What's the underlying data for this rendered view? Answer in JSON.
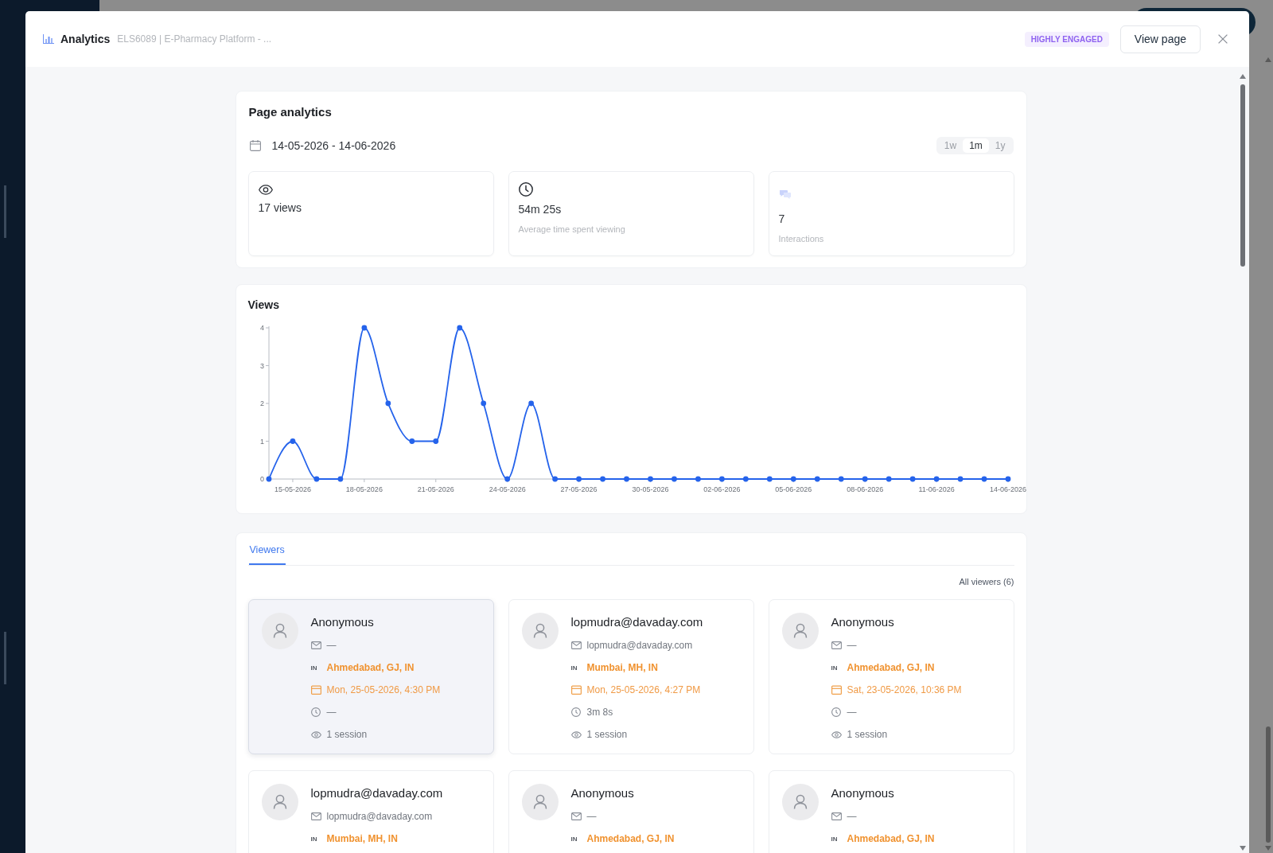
{
  "modal": {
    "title": "Analytics",
    "subtitle": "ELS6089 | E-Pharmacy Platform - ...",
    "badge": "HIGHLY ENGAGED",
    "view_button": "View page"
  },
  "page_analytics": {
    "title": "Page analytics",
    "date_range": "14-05-2026 - 14-06-2026",
    "ranges": [
      {
        "label": "1w",
        "selected": false
      },
      {
        "label": "1m",
        "selected": true
      },
      {
        "label": "1y",
        "selected": false
      }
    ],
    "stats": [
      {
        "kind": "views",
        "value": "17 views"
      },
      {
        "kind": "time",
        "value": "54m 25s",
        "caption": "Average time spent viewing"
      },
      {
        "kind": "interactions",
        "value": "7",
        "caption": "Interactions"
      }
    ]
  },
  "views_chart": {
    "chart_data": {
      "type": "line",
      "title": "Views",
      "categories": [
        null,
        "15-05-2026",
        null,
        null,
        "18-05-2026",
        null,
        null,
        "21-05-2026",
        null,
        null,
        "24-05-2026",
        null,
        null,
        "27-05-2026",
        null,
        null,
        "30-05-2026",
        null,
        null,
        "02-06-2026",
        null,
        null,
        "05-06-2026",
        null,
        null,
        "08-06-2026",
        null,
        null,
        "11-06-2026",
        null,
        null,
        "14-06-2026"
      ],
      "ylim": [
        0,
        4
      ],
      "yticks": [
        0,
        1,
        2,
        3,
        4
      ],
      "series": [
        {
          "color": "#2563eb",
          "marker": "circle",
          "values": [
            0,
            1,
            0,
            0,
            4,
            2,
            1,
            1,
            4,
            2,
            0,
            2,
            0,
            0,
            0,
            0,
            0,
            0,
            0,
            0,
            0,
            0,
            0,
            0,
            0,
            0,
            0,
            0,
            0,
            0,
            0,
            0
          ]
        }
      ]
    }
  },
  "viewers": {
    "tabs": [
      {
        "label": "Viewers",
        "selected": true
      }
    ],
    "all_viewers": "All viewers (6)",
    "cards": [
      {
        "name": "Anonymous",
        "email": "—",
        "country": "IN",
        "location": "Ahmedabad, GJ, IN",
        "last_seen": "Mon, 25-05-2026, 4:30 PM",
        "duration": "—",
        "sessions": "1 session",
        "selected": true
      },
      {
        "name": "lopmudra@davaday.com",
        "email": "lopmudra@davaday.com",
        "country": "IN",
        "location": "Mumbai, MH, IN",
        "last_seen": "Mon, 25-05-2026, 4:27 PM",
        "duration": "3m 8s",
        "sessions": "1 session",
        "selected": false
      },
      {
        "name": "Anonymous",
        "email": "—",
        "country": "IN",
        "location": "Ahmedabad, GJ, IN",
        "last_seen": "Sat, 23-05-2026, 10:36 PM",
        "duration": "—",
        "sessions": "1 session",
        "selected": false
      },
      {
        "name": "lopmudra@davaday.com",
        "email": "lopmudra@davaday.com",
        "country": "IN",
        "location": "Mumbai, MH, IN",
        "selected": false
      },
      {
        "name": "Anonymous",
        "email": "—",
        "country": "IN",
        "location": "Ahmedabad, GJ, IN",
        "selected": false
      },
      {
        "name": "Anonymous",
        "email": "—",
        "country": "IN",
        "location": "Ahmedabad, GJ, IN",
        "selected": false
      }
    ]
  }
}
